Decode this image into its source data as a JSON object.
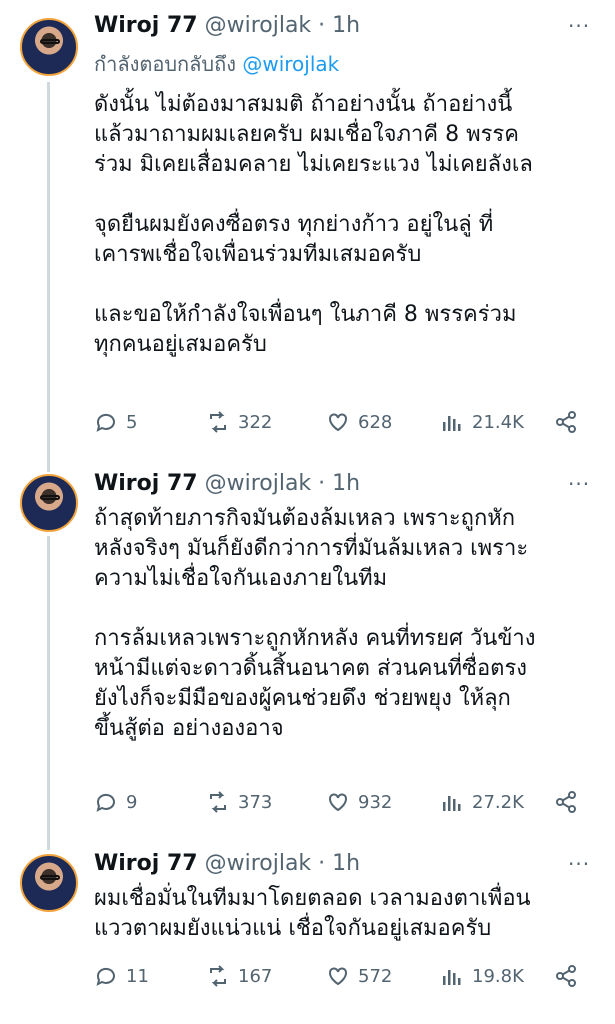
{
  "tweets": [
    {
      "name": "Wiroj 77",
      "handle": "@wirojlak",
      "sep": "·",
      "time": "1h",
      "replying_prefix": "กำลังตอบกลับถึง",
      "replying_to": "@wirojlak",
      "text": "ดังนั้น ไม่ต้องมาสมมติ ถ้าอย่างนั้น ถ้าอย่างนี้\nแล้วมาถามผมเลยครับ ผมเชื่อใจภาคี 8 พรรค\nร่วม มิเคยเสื่อมคลาย ไม่เคยระแวง ไม่เคยลังเล\n\nจุดยืนผมยังคงซื่อตรง ทุกย่างก้าว อยู่ในลู่ ที่\nเคารพเชื่อใจเพื่อนร่วมทีมเสมอครับ\n\nและขอให้กำลังใจเพื่อนๆ ในภาคี 8 พรรคร่วม\nทุกคนอยู่เสมอครับ",
      "replies": "5",
      "retweets": "322",
      "likes": "628",
      "views": "21.4K"
    },
    {
      "name": "Wiroj 77",
      "handle": "@wirojlak",
      "sep": "·",
      "time": "1h",
      "text": "ถ้าสุดท้ายภารกิจมันต้องล้มเหลว เพราะถูกหัก\nหลังจริงๆ มันก็ยังดีกว่าการที่มันล้มเหลว เพราะ\nความไม่เชื่อใจกันเองภายในทีม\n\nการล้มเหลวเพราะถูกหักหลัง คนที่ทรยศ วันข้าง\nหน้ามีแต่จะดาวดิ้นสิ้นอนาคต ส่วนคนที่ซื่อตรง\nยังไงก็จะมีมือของผู้คนช่วยดึง ช่วยพยุง ให้ลุก\nขึ้นสู้ต่อ อย่างองอาจ",
      "replies": "9",
      "retweets": "373",
      "likes": "932",
      "views": "27.2K"
    },
    {
      "name": "Wiroj 77",
      "handle": "@wirojlak",
      "sep": "·",
      "time": "1h",
      "text": "ผมเชื่อมั่นในทีมมาโดยตลอด เวลามองตาเพื่อน\nแววตาผมยังแน่วแน่ เชื่อใจกันอยู่เสมอครับ",
      "replies": "11",
      "retweets": "167",
      "likes": "572",
      "views": "19.8K"
    }
  ],
  "more_glyph": "···",
  "colors": {
    "accent": "#1d9bf0",
    "muted": "#536471",
    "thread": "#cfd9de",
    "avatar_ring": "#f2a33b"
  },
  "icons": [
    "reply-icon",
    "retweet-icon",
    "like-icon",
    "views-icon",
    "share-icon",
    "more-icon"
  ]
}
